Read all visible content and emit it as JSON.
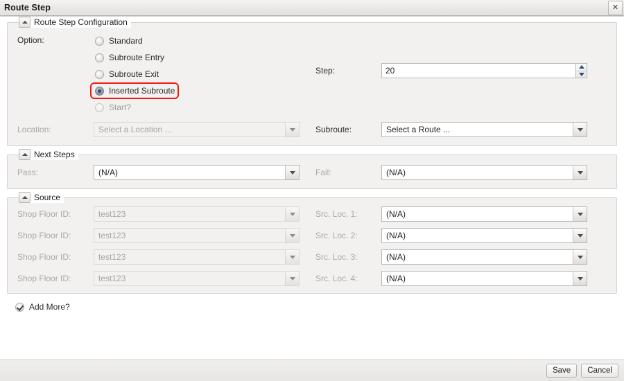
{
  "window": {
    "title": "Route Step",
    "close_label": "✕"
  },
  "groups": {
    "config": {
      "legend": "Route Step Configuration",
      "option_label": "Option:",
      "options": [
        {
          "label": "Standard",
          "checked": false,
          "disabled": false
        },
        {
          "label": "Subroute Entry",
          "checked": false,
          "disabled": false
        },
        {
          "label": "Subroute Exit",
          "checked": false,
          "disabled": false
        },
        {
          "label": "Inserted Subroute",
          "checked": true,
          "disabled": false
        },
        {
          "label": "Start?",
          "checked": false,
          "disabled": true
        }
      ],
      "step_label": "Step:",
      "step_value": "20",
      "location_label": "Location:",
      "location_value": "Select a Location ...",
      "subroute_label": "Subroute:",
      "subroute_value": "Select a Route ..."
    },
    "next_steps": {
      "legend": "Next Steps",
      "pass_label": "Pass:",
      "pass_value": "(N/A)",
      "fail_label": "Fail:",
      "fail_value": "(N/A)"
    },
    "source": {
      "legend": "Source",
      "rows": [
        {
          "shop_floor_label": "Shop Floor ID:",
          "shop_floor_value": "test123",
          "src_loc_label": "Src. Loc. 1:",
          "src_loc_value": "(N/A)"
        },
        {
          "shop_floor_label": "Shop Floor ID:",
          "shop_floor_value": "test123",
          "src_loc_label": "Src. Loc. 2:",
          "src_loc_value": "(N/A)"
        },
        {
          "shop_floor_label": "Shop Floor ID:",
          "shop_floor_value": "test123",
          "src_loc_label": "Src. Loc. 3:",
          "src_loc_value": "(N/A)"
        },
        {
          "shop_floor_label": "Shop Floor ID:",
          "shop_floor_value": "test123",
          "src_loc_label": "Src. Loc. 4:",
          "src_loc_value": "(N/A)"
        }
      ]
    }
  },
  "add_more": {
    "label": "Add More?",
    "checked": true
  },
  "footer": {
    "save_label": "Save",
    "cancel_label": "Cancel"
  },
  "colors": {
    "highlight": "#ee1b11",
    "panel": "#f2f1ef",
    "spinner_arrow": "#2e4a7d"
  }
}
